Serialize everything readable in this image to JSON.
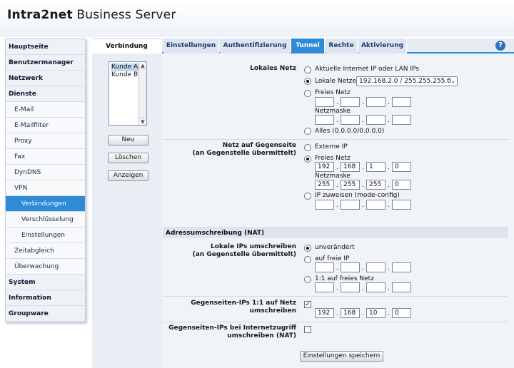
{
  "header": {
    "logo_bold": "Intra2net",
    "logo_rest": " Business Server"
  },
  "sidebar": {
    "items": [
      {
        "label": "Hauptseite"
      },
      {
        "label": "Benutzermanager"
      },
      {
        "label": "Netzwerk"
      },
      {
        "label": "Dienste"
      },
      {
        "label": "E-Mail"
      },
      {
        "label": "E-Mailfilter"
      },
      {
        "label": "Proxy"
      },
      {
        "label": "Fax"
      },
      {
        "label": "DynDNS"
      },
      {
        "label": "VPN"
      },
      {
        "label": "Verbindungen"
      },
      {
        "label": "Verschlüsselung"
      },
      {
        "label": "Einstellungen"
      },
      {
        "label": "Zeitabgleich"
      },
      {
        "label": "Überwachung"
      },
      {
        "label": "System"
      },
      {
        "label": "Information"
      },
      {
        "label": "Groupware"
      }
    ]
  },
  "tabs": [
    {
      "label": "Verbindung"
    },
    {
      "label": "Einstellungen"
    },
    {
      "label": "Authentifizierung"
    },
    {
      "label": "Tunnel"
    },
    {
      "label": "Rechte"
    },
    {
      "label": "Aktivierung"
    }
  ],
  "help": {
    "glyph": "?"
  },
  "connections": {
    "items": [
      "Kunde A",
      "Kunde B"
    ],
    "scroll_up": "▲",
    "scroll_down": "▼",
    "new_label": "Neu",
    "delete_label": "Löschen",
    "show_label": "Anzeigen"
  },
  "local_net": {
    "label": "Lokales Netz",
    "opt_current": "Aktuelle Internet IP oder LAN IPs",
    "opt_local": "Lokale Netze",
    "local_select": "192.168.2.0 / 255.255.255.0",
    "select_arrow": "⌃⌄",
    "opt_free": "Freies Netz",
    "netmask_label": "Netzmaske",
    "opt_all": "Alles (0.0.0.0/0.0.0.0)"
  },
  "remote_net": {
    "label_line1": "Netz auf Gegenseite",
    "label_line2": "(an Gegenstelle übermittelt)",
    "opt_external": "Externe IP",
    "opt_free": "Freies Netz",
    "ip": [
      "192",
      "168",
      "1",
      "0"
    ],
    "netmask_label": "Netzmaske",
    "mask": [
      "255",
      "255",
      "255",
      "0"
    ],
    "opt_assign": "IP zuweisen (mode-config)"
  },
  "nat": {
    "section_title": "Adressumschreibung (NAT)",
    "local_label_line1": "Lokale IPs umschreiben",
    "local_label_line2": "(an Gegenstelle übermittelt)",
    "opt_unchanged": "unverändert",
    "opt_free_ip": "auf freie IP",
    "opt_one_to_one": "1:1 auf freies Netz",
    "remote_label_line1": "Gegenseiten-IPs 1:1 auf Netz",
    "remote_label_line2": "umschreiben",
    "remote_check": "✓",
    "remote_ip": [
      "192",
      "168",
      "10",
      "0"
    ],
    "internet_label_line1": "Gegenseiten-IPs bei Internetzugriff",
    "internet_label_line2": "umschreiben (NAT)"
  },
  "save_label": "Einstellungen speichern",
  "colors": {
    "accent": "#2f8ad8",
    "sidebar_bg": "#f4f6fa",
    "panel_bg": "#f0f3f8"
  }
}
